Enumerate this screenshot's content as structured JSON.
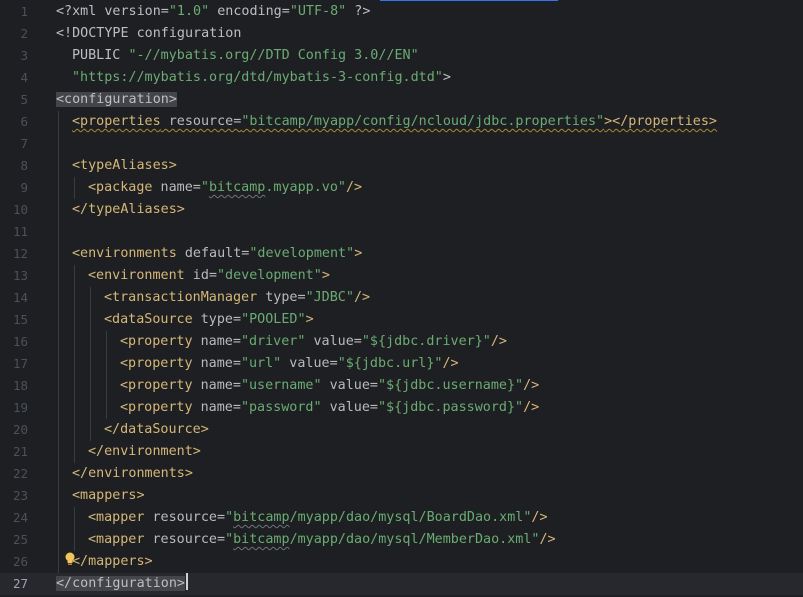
{
  "editor": {
    "current_line": 27,
    "lines": [
      {
        "n": "1",
        "indent": 0,
        "segs": [
          [
            "plain",
            "<?xml version="
          ],
          [
            "str",
            "\"1.0\""
          ],
          [
            "plain",
            " encoding="
          ],
          [
            "str",
            "\"UTF-8\""
          ],
          [
            "plain",
            " ?>"
          ]
        ]
      },
      {
        "n": "2",
        "indent": 0,
        "segs": [
          [
            "plain",
            "<!DOCTYPE configuration"
          ]
        ]
      },
      {
        "n": "3",
        "indent": 1,
        "segs": [
          [
            "plain",
            "PUBLIC "
          ],
          [
            "str",
            "\"-//mybatis.org//DTD Config 3.0//EN\""
          ]
        ]
      },
      {
        "n": "4",
        "indent": 1,
        "segs": [
          [
            "str",
            "\"https://mybatis.org/dtd/mybatis-3-config.dtd\""
          ],
          [
            "plain",
            ">"
          ]
        ]
      },
      {
        "n": "5",
        "indent": 0,
        "segs": [
          [
            "tag-hl",
            "<configuration>"
          ]
        ]
      },
      {
        "n": "6",
        "indent": 1,
        "segs": [
          [
            "tag-wy",
            "<properties"
          ],
          [
            "attr-wy",
            " resource="
          ],
          [
            "str-wy",
            "\"bitcamp/myapp/config/ncloud/jdbc.properties\""
          ],
          [
            "tag-wy",
            "></properties>"
          ]
        ]
      },
      {
        "n": "7",
        "indent": 0,
        "segs": []
      },
      {
        "n": "8",
        "indent": 1,
        "segs": [
          [
            "tag",
            "<typeAliases>"
          ]
        ]
      },
      {
        "n": "9",
        "indent": 2,
        "segs": [
          [
            "tag",
            "<package"
          ],
          [
            "attr",
            " name="
          ],
          [
            "str",
            "\""
          ],
          [
            "str-w",
            "bitcamp"
          ],
          [
            "str",
            ".myapp.vo\""
          ],
          [
            "tag",
            "/>"
          ]
        ]
      },
      {
        "n": "10",
        "indent": 1,
        "segs": [
          [
            "tag",
            "</typeAliases>"
          ]
        ]
      },
      {
        "n": "11",
        "indent": 0,
        "segs": []
      },
      {
        "n": "12",
        "indent": 1,
        "segs": [
          [
            "tag",
            "<environments"
          ],
          [
            "attr",
            " default="
          ],
          [
            "str",
            "\"development\""
          ],
          [
            "tag",
            ">"
          ]
        ]
      },
      {
        "n": "13",
        "indent": 2,
        "segs": [
          [
            "tag",
            "<environment"
          ],
          [
            "attr",
            " id="
          ],
          [
            "str",
            "\"development\""
          ],
          [
            "tag",
            ">"
          ]
        ]
      },
      {
        "n": "14",
        "indent": 3,
        "segs": [
          [
            "tag",
            "<transactionManager"
          ],
          [
            "attr",
            " type="
          ],
          [
            "str",
            "\"JDBC\""
          ],
          [
            "tag",
            "/>"
          ]
        ]
      },
      {
        "n": "15",
        "indent": 3,
        "segs": [
          [
            "tag",
            "<dataSource"
          ],
          [
            "attr",
            " type="
          ],
          [
            "str",
            "\"POOLED\""
          ],
          [
            "tag",
            ">"
          ]
        ]
      },
      {
        "n": "16",
        "indent": 4,
        "segs": [
          [
            "tag",
            "<property"
          ],
          [
            "attr",
            " name="
          ],
          [
            "str",
            "\"driver\""
          ],
          [
            "attr",
            " value="
          ],
          [
            "str",
            "\"${jdbc.driver}\""
          ],
          [
            "tag",
            "/>"
          ]
        ]
      },
      {
        "n": "17",
        "indent": 4,
        "segs": [
          [
            "tag",
            "<property"
          ],
          [
            "attr",
            " name="
          ],
          [
            "str",
            "\"url\""
          ],
          [
            "attr",
            " value="
          ],
          [
            "str",
            "\"${jdbc.url}\""
          ],
          [
            "tag",
            "/>"
          ]
        ]
      },
      {
        "n": "18",
        "indent": 4,
        "segs": [
          [
            "tag",
            "<property"
          ],
          [
            "attr",
            " name="
          ],
          [
            "str",
            "\"username\""
          ],
          [
            "attr",
            " value="
          ],
          [
            "str",
            "\"${jdbc.username}\""
          ],
          [
            "tag",
            "/>"
          ]
        ]
      },
      {
        "n": "19",
        "indent": 4,
        "segs": [
          [
            "tag",
            "<property"
          ],
          [
            "attr",
            " name="
          ],
          [
            "str",
            "\"password\""
          ],
          [
            "attr",
            " value="
          ],
          [
            "str",
            "\"${jdbc.password}\""
          ],
          [
            "tag",
            "/>"
          ]
        ]
      },
      {
        "n": "20",
        "indent": 3,
        "segs": [
          [
            "tag",
            "</dataSource>"
          ]
        ]
      },
      {
        "n": "21",
        "indent": 2,
        "segs": [
          [
            "tag",
            "</environment>"
          ]
        ]
      },
      {
        "n": "22",
        "indent": 1,
        "segs": [
          [
            "tag",
            "</environments>"
          ]
        ]
      },
      {
        "n": "23",
        "indent": 1,
        "segs": [
          [
            "tag",
            "<mappers>"
          ]
        ]
      },
      {
        "n": "24",
        "indent": 2,
        "segs": [
          [
            "tag",
            "<mapper"
          ],
          [
            "attr",
            " resource="
          ],
          [
            "str",
            "\""
          ],
          [
            "str-w",
            "bitcamp"
          ],
          [
            "str",
            "/myapp/dao/mysql/BoardDao.xml\""
          ],
          [
            "tag",
            "/>"
          ]
        ]
      },
      {
        "n": "25",
        "indent": 2,
        "segs": [
          [
            "tag",
            "<mapper"
          ],
          [
            "attr",
            " resource="
          ],
          [
            "str",
            "\""
          ],
          [
            "str-w",
            "bitcamp"
          ],
          [
            "str",
            "/myapp/dao/mysql/MemberDao.xml\""
          ],
          [
            "tag",
            "/>"
          ]
        ]
      },
      {
        "n": "26",
        "indent": 1,
        "segs": [
          [
            "tag",
            "</mappers>"
          ]
        ]
      },
      {
        "n": "27",
        "indent": 0,
        "segs": [
          [
            "tag-hl",
            "</configuration>"
          ]
        ]
      }
    ]
  },
  "icons": {
    "intention_bulb": "lightbulb-icon"
  },
  "colors": {
    "background": "#1e1f22",
    "current_line": "#26282e",
    "tag": "#d5b778",
    "string": "#6aab73",
    "attribute": "#bababa",
    "line_number": "#4b5059",
    "accent": "#3574f0"
  }
}
